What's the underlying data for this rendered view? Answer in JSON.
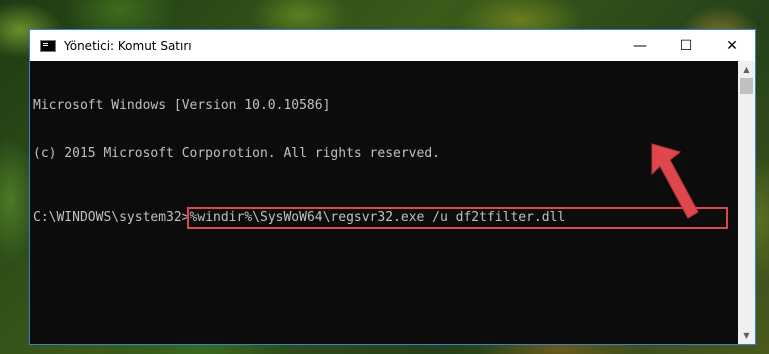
{
  "window": {
    "title": "Yönetici: Komut Satırı",
    "controls": {
      "minimize": "—",
      "maximize": "☐",
      "close": "✕"
    }
  },
  "console": {
    "line1": "Microsoft Windows [Version 10.0.10586]",
    "line2": "(c) 2015 Microsoft Corporotion. All rights reserved.",
    "prompt": "C:\\WINDOWS\\system32>",
    "command": "%windir%\\SysWoW64\\regsvr32.exe /u df2tfilter.dll"
  },
  "colors": {
    "console_bg": "#0c0c0c",
    "console_text": "#c0c0c0",
    "highlight_box": "#e0474c",
    "annotation_arrow": "#e0474c",
    "window_border": "#3b7fd0"
  }
}
